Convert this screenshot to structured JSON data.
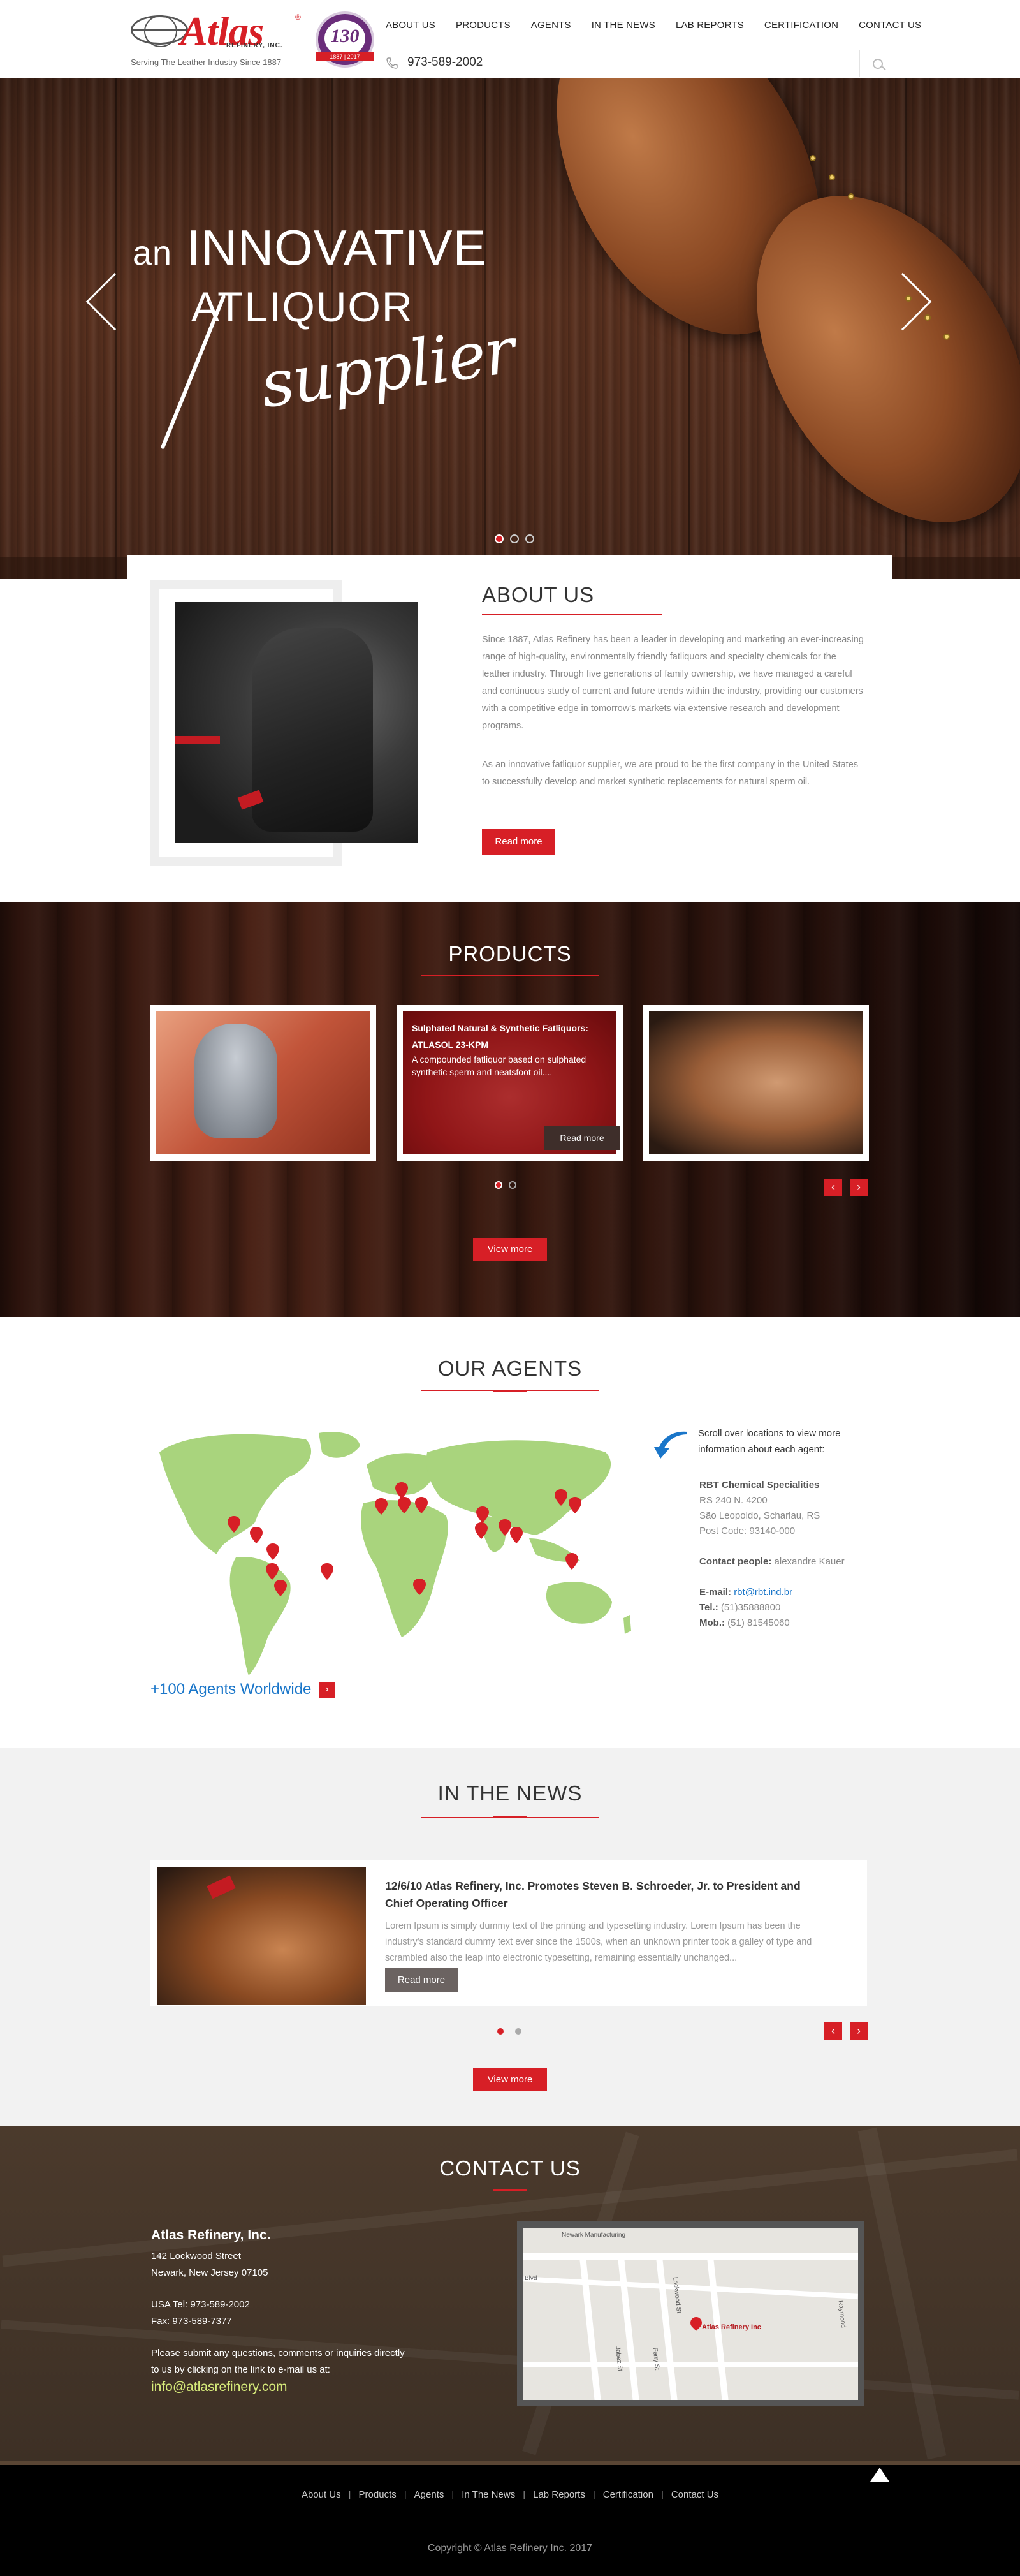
{
  "header": {
    "logo_text": "Atlas",
    "logo_sub": "REFINERY, INC.",
    "logo_reg": "®",
    "tagline": "Serving The Leather Industry Since 1887",
    "badge_number": "130",
    "badge_ribbon": "1887 | 2017",
    "nav": [
      "ABOUT US",
      "PRODUCTS",
      "AGENTS",
      "IN THE NEWS",
      "LAB REPORTS",
      "CERTIFICATION",
      "CONTACT US"
    ],
    "phone": "973-589-2002",
    "icons": {
      "phone": "phone-icon",
      "search": "search-icon"
    }
  },
  "hero": {
    "line1_small": "an",
    "line1_big": "INNOVATIVE",
    "line2": "ATLIQUOR",
    "line3": "supplier",
    "slides": 3,
    "active_slide": 1
  },
  "about": {
    "title": "ABOUT US",
    "para1": "Since 1887, Atlas Refinery has been a leader in developing and marketing an ever-increasing range of high-quality, environmentally friendly fatliquors and specialty chemicals for the leather industry.  Through five generations of family ownership, we have managed a careful and continuous study of current and future trends within the industry, providing our customers with a competitive edge in tomorrow's markets via extensive research and development programs.",
    "para2": "As an innovative fatliquor supplier, we are proud to be the first company in the United States to successfully develop and market synthetic replacements for natural sperm oil.",
    "button": "Read more"
  },
  "products": {
    "title": "PRODUCTS",
    "cards": [
      {
        "name": "cat-on-leather-sofa"
      },
      {
        "title": "Sulphated Natural & Synthetic Fatliquors: ATLASOL 23-KPM",
        "desc": "A compounded fatliquor based on sulphated synthetic sperm and neatsfoot oil....",
        "button": "Read more"
      },
      {
        "name": "tan-leather-car-seat"
      }
    ],
    "pages": 2,
    "active_page": 1,
    "view_more": "View more",
    "prev": "‹",
    "next": "›"
  },
  "agents": {
    "title": "OUR AGENTS",
    "hint": "Scroll over locations to view more information about each agent:",
    "agent": {
      "name": "RBT Chemical Specialities",
      "address1": "RS 240 N. 4200",
      "address2": "São Leopoldo, Scharlau, RS",
      "postcode": "Post Code: 93140-000",
      "contact_label": "Contact people:",
      "contact_name": "alexandre Kauer",
      "email_label": "E-mail:",
      "email": "rbt@rbt.ind.br",
      "tel_label": "Tel.:",
      "tel": "(51)35888800",
      "mob_label": "Mob.:",
      "mob": "(51) 81545060"
    },
    "worldwide": "+100 Agents Worldwide",
    "worldwide_arrow": "›",
    "map_color": "#a9d47d"
  },
  "news": {
    "title": "IN THE NEWS",
    "item_title": "12/6/10 Atlas Refinery, Inc. Promotes Steven B. Schroeder, Jr. to President and Chief Operating Officer",
    "item_text": "Lorem Ipsum is simply dummy text of the printing and typesetting industry. Lorem Ipsum has been the industry's standard dummy text ever since the 1500s, when an unknown printer took a galley of type and scrambled also the leap into electronic typesetting, remaining essentially unchanged...",
    "button": "Read more",
    "pages": 2,
    "active_page": 1,
    "view_more": "View more",
    "prev": "‹",
    "next": "›"
  },
  "contact": {
    "title": "CONTACT US",
    "company": "Atlas Refinery, Inc.",
    "street": "142 Lockwood Street",
    "city": "Newark, New Jersey 07105",
    "tel": "USA Tel: 973-589-2002",
    "fax": "Fax: 973-589-7377",
    "note": "Please submit any questions, comments or inquiries directly to us by clicking on the link to e-mail us at:",
    "email": "info@atlasrefinery.com",
    "map": {
      "top_label": "Newark Manufacturing",
      "pin_label": "Atlas Refinery Inc",
      "street1": "Lockwood St",
      "street2": "Jabez St",
      "street3": "Ferry St",
      "label_left": "Blvd",
      "label_right": "Raymond"
    }
  },
  "footer": {
    "links": [
      "About Us",
      "Products",
      "Agents",
      "In The News",
      "Lab Reports",
      "Certification",
      "Contact Us"
    ],
    "separator": "|",
    "copyright": "Copyright © Atlas Refinery Inc. 2017"
  },
  "colors": {
    "accent": "#d71f26",
    "link_blue": "#1a76c9",
    "email_green": "#d6ea7a",
    "badge_purple": "#6a2d7a"
  }
}
